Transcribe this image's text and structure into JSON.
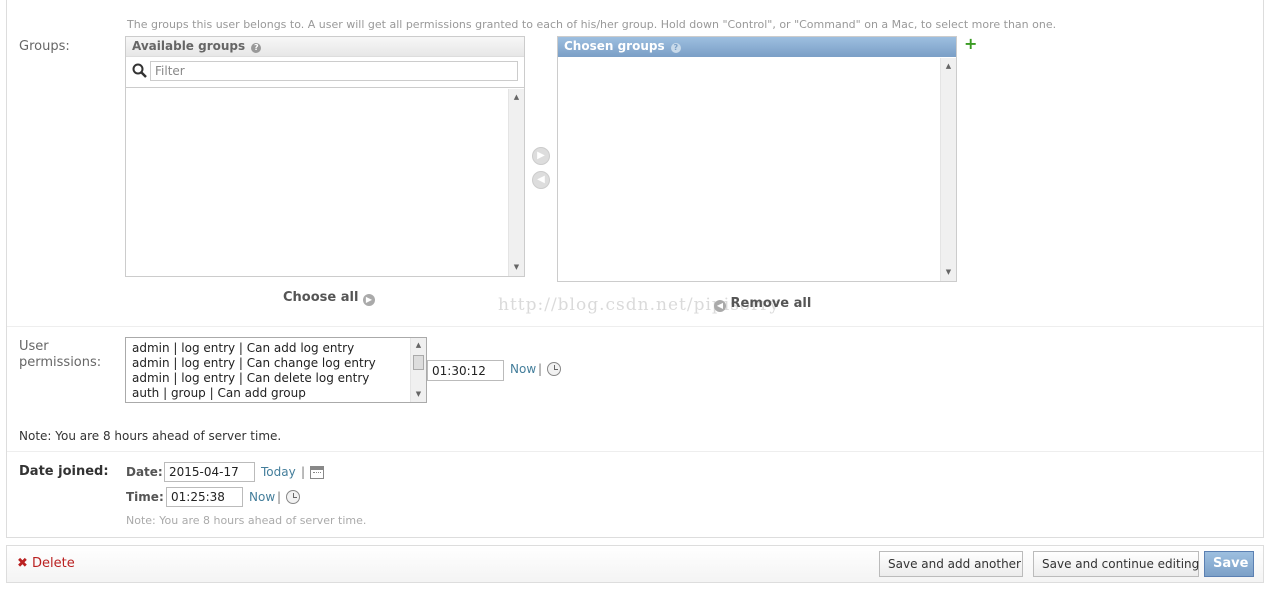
{
  "groups": {
    "label": "Groups:",
    "help": "The groups this user belongs to. A user will get all permissions granted to each of his/her group. Hold down \"Control\", or \"Command\" on a Mac, to select more than one.",
    "available_title": "Available groups",
    "filter_placeholder": "Filter",
    "chosen_title": "Chosen groups",
    "choose_all": "Choose all",
    "remove_all": "Remove all",
    "help_glyph": "?",
    "add_glyph": "+"
  },
  "user_permissions": {
    "label_line1": "User",
    "label_line2": "permissions:",
    "items": [
      "admin | log entry | Can add log entry",
      "admin | log entry | Can change log entry",
      "admin | log entry | Can delete log entry",
      "auth | group | Can add group"
    ],
    "time_value": "01:30:12",
    "now_label": "Now",
    "separator": "|",
    "note": "Note: You are 8 hours ahead of server time."
  },
  "date_joined": {
    "label": "Date joined:",
    "date_label": "Date:",
    "date_value": "2015-04-17",
    "today_label": "Today",
    "time_label": "Time:",
    "time_value": "01:25:38",
    "now_label": "Now",
    "separator": "|",
    "note": "Note: You are 8 hours ahead of server time."
  },
  "watermark": "http://blog.csdn.net/pipisorry",
  "submit_row": {
    "delete_label": "Delete",
    "delete_glyph": "✖",
    "save_add_another": "Save and add another",
    "save_continue": "Save and continue editing",
    "save": "Save"
  },
  "colors": {
    "chosen_header": "#7ca0c7",
    "link": "#447e9b",
    "delete": "#ba2121",
    "add_green": "#3a9b22"
  }
}
